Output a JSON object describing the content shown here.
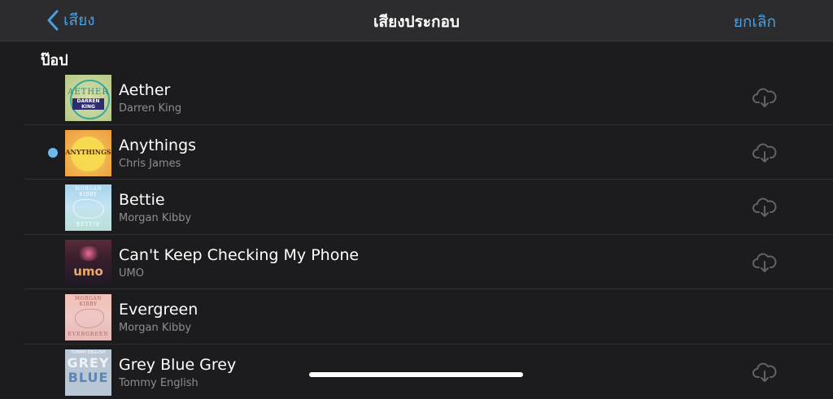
{
  "nav": {
    "back_label": "เสียง",
    "title": "เสียงประกอบ",
    "cancel_label": "ยกเลิก"
  },
  "section": {
    "title": "ป๊อป"
  },
  "songs": [
    {
      "title": "Aether",
      "artist": "Darren King",
      "art_text_top": "AETHER",
      "art_text_bottom": "DARREN KING",
      "playing": false,
      "downloadable": true
    },
    {
      "title": "Anythings",
      "artist": "Chris James",
      "art_text_top": "ANYTHINGS",
      "playing": true,
      "downloadable": true
    },
    {
      "title": "Bettie",
      "artist": "Morgan Kibby",
      "art_text_top": "MORGAN KIBBY",
      "art_text_bottom": "BETTIE",
      "playing": false,
      "downloadable": true
    },
    {
      "title": "Can't Keep Checking My Phone",
      "artist": "UMO",
      "art_text_top": "umo",
      "playing": false,
      "downloadable": true
    },
    {
      "title": "Evergreen",
      "artist": "Morgan Kibby",
      "art_text_top": "MORGAN KIBBY",
      "art_text_bottom": "EVERGREEN",
      "playing": false,
      "downloadable": false
    },
    {
      "title": "Grey Blue Grey",
      "artist": "Tommy English",
      "art_text_top": "TOMMY ENGLISH",
      "art_text_mid": "GREY",
      "art_text_bottom": "BLUE",
      "playing": false,
      "downloadable": true
    }
  ],
  "colors": {
    "accent": "#4a9fe0",
    "now_playing_dot": "#6cb8f0",
    "background": "#1c1c1e",
    "navbar": "#2c2c2e",
    "secondary_text": "#8e8e93",
    "cloud_icon": "#636366"
  },
  "icons": {
    "back": "chevron-left-icon",
    "download": "cloud-download-icon"
  }
}
